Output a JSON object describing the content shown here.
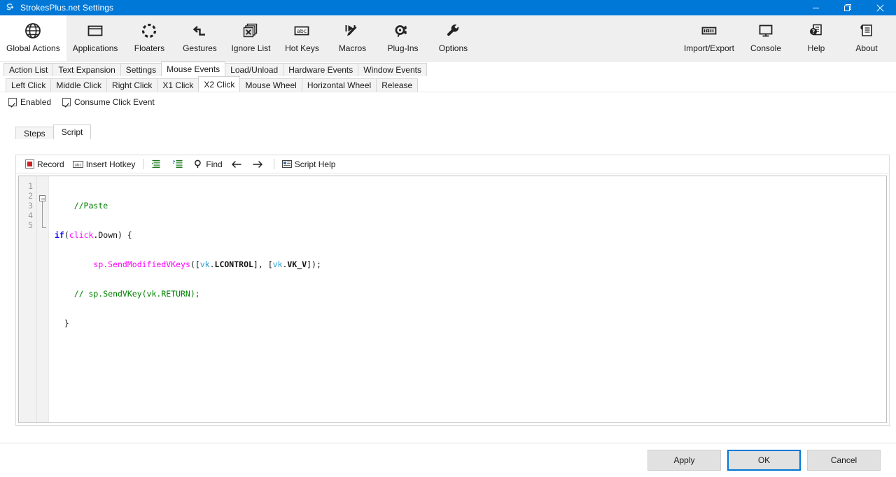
{
  "window": {
    "title": "StrokesPlus.net Settings",
    "app_icon": "strokesplus-logo-icon",
    "accent": "#0078d7",
    "controls": {
      "minimize": "minimize-icon",
      "maximize": "restore-icon",
      "close": "close-icon"
    }
  },
  "ribbon": {
    "left": [
      {
        "label": "Global Actions",
        "icon": "globe-icon",
        "active": true
      },
      {
        "label": "Applications",
        "icon": "window-icon",
        "active": false
      },
      {
        "label": "Floaters",
        "icon": "dotted-circle-icon",
        "active": false
      },
      {
        "label": "Gestures",
        "icon": "gesture-arrow-icon",
        "active": false
      },
      {
        "label": "Ignore List",
        "icon": "stacked-x-icon",
        "active": false
      },
      {
        "label": "Hot Keys",
        "icon": "abc-key-icon",
        "active": false
      },
      {
        "label": "Macros",
        "icon": "macro-play-icon",
        "active": false
      },
      {
        "label": "Plug-Ins",
        "icon": "plugin-icon",
        "active": false
      },
      {
        "label": "Options",
        "icon": "wrench-icon",
        "active": false
      }
    ],
    "right": [
      {
        "label": "Import/Export",
        "icon": "import-export-icon",
        "active": false
      },
      {
        "label": "Console",
        "icon": "monitor-icon",
        "active": false
      },
      {
        "label": "Help",
        "icon": "help-doc-icon",
        "active": false
      },
      {
        "label": "About",
        "icon": "about-list-icon",
        "active": false
      }
    ]
  },
  "primary_tabs": [
    {
      "label": "Action List",
      "selected": false
    },
    {
      "label": "Text Expansion",
      "selected": false
    },
    {
      "label": "Settings",
      "selected": false
    },
    {
      "label": "Mouse Events",
      "selected": true
    },
    {
      "label": "Load/Unload",
      "selected": false
    },
    {
      "label": "Hardware Events",
      "selected": false
    },
    {
      "label": "Window Events",
      "selected": false
    }
  ],
  "secondary_tabs": [
    {
      "label": "Left Click",
      "selected": false
    },
    {
      "label": "Middle Click",
      "selected": false
    },
    {
      "label": "Right Click",
      "selected": false
    },
    {
      "label": "X1 Click",
      "selected": false
    },
    {
      "label": "X2 Click",
      "selected": true
    },
    {
      "label": "Mouse Wheel",
      "selected": false
    },
    {
      "label": "Horizontal Wheel",
      "selected": false
    },
    {
      "label": "Release",
      "selected": false
    }
  ],
  "options": {
    "enabled": {
      "label": "Enabled",
      "checked": true
    },
    "consume_click_event": {
      "label": "Consume Click Event",
      "checked": true
    }
  },
  "inner_tabs": [
    {
      "label": "Steps",
      "selected": false
    },
    {
      "label": "Script",
      "selected": true
    }
  ],
  "script_toolbar": [
    {
      "label": "Record",
      "icon": "record-icon"
    },
    {
      "label": "Insert Hotkey",
      "icon": "hotkey-icon"
    },
    {
      "label": "",
      "icon": "format-indent-icon"
    },
    {
      "label": "",
      "icon": "comment-lines-icon"
    },
    {
      "label": "Find",
      "icon": "search-icon"
    },
    {
      "label": "",
      "icon": "arrow-left-icon"
    },
    {
      "label": "",
      "icon": "arrow-right-icon"
    },
    {
      "label": "Script Help",
      "icon": "script-help-icon"
    }
  ],
  "editor": {
    "line_numbers": [
      "1",
      "2",
      "3",
      "4",
      "5"
    ],
    "lines": [
      "    //Paste",
      "if(click.Down) {",
      "        sp.SendModifiedVKeys([vk.LCONTROL], [vk.VK_V]);",
      "    // sp.SendVKey(vk.RETURN);",
      "  }"
    ],
    "colors": {
      "comment": "#008000",
      "keyword": "#0000ff",
      "object": "#ff00ff",
      "namespace": "#2a9fd6",
      "constant": "#101010"
    }
  },
  "footer": {
    "apply": "Apply",
    "ok": "OK",
    "cancel": "Cancel"
  }
}
